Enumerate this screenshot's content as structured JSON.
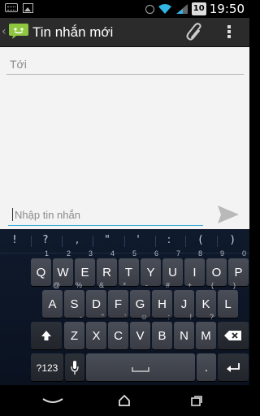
{
  "status_bar": {
    "clock": "19:50",
    "battery_level": "10"
  },
  "action_bar": {
    "up_glyph": "‹",
    "title": "Tin nhắn mới",
    "icons": [
      "messaging-app-icon",
      "attach-icon",
      "overflow-menu-icon"
    ]
  },
  "compose": {
    "recipient_placeholder": "Tới",
    "message_placeholder": "Nhập tin nhắn",
    "send_icon": "send-icon"
  },
  "keyboard": {
    "suggestions": [
      "!",
      "?",
      ",",
      "\"",
      "'",
      ":",
      "(",
      ")"
    ],
    "row1": [
      {
        "label": "Q",
        "hint": "1"
      },
      {
        "label": "W",
        "hint": "2"
      },
      {
        "label": "E",
        "hint": "3"
      },
      {
        "label": "R",
        "hint": "4"
      },
      {
        "label": "T",
        "hint": "5"
      },
      {
        "label": "Y",
        "hint": "6"
      },
      {
        "label": "U",
        "hint": "7"
      },
      {
        "label": "I",
        "hint": "8"
      },
      {
        "label": "O",
        "hint": "9"
      },
      {
        "label": "P",
        "hint": "0"
      }
    ],
    "row2": [
      {
        "label": "A",
        "hint": "@"
      },
      {
        "label": "S",
        "hint": "%"
      },
      {
        "label": "D",
        "hint": "&"
      },
      {
        "label": "F",
        "hint": "*"
      },
      {
        "label": "G",
        "hint": "-"
      },
      {
        "label": "H",
        "hint": "#"
      },
      {
        "label": "J",
        "hint": "+"
      },
      {
        "label": "K",
        "hint": "("
      },
      {
        "label": "L",
        "hint": ")"
      }
    ],
    "row3": [
      {
        "label": "Z",
        "hint": "-"
      },
      {
        "label": "X",
        "hint": "\""
      },
      {
        "label": "C",
        "hint": "'"
      },
      {
        "label": "V",
        "hint": "☺"
      },
      {
        "label": "B",
        "hint": ":"
      },
      {
        "label": "N",
        "hint": "!"
      },
      {
        "label": "M",
        "hint": "?"
      }
    ],
    "mode_key": "?123",
    "period_key": ".",
    "shift_icon": "shift-icon",
    "backspace_icon": "backspace-icon",
    "mic_icon": "microphone-icon",
    "enter_icon": "enter-icon"
  },
  "nav_bar": {
    "icons": [
      "back-icon",
      "home-icon",
      "recent-apps-icon"
    ]
  }
}
